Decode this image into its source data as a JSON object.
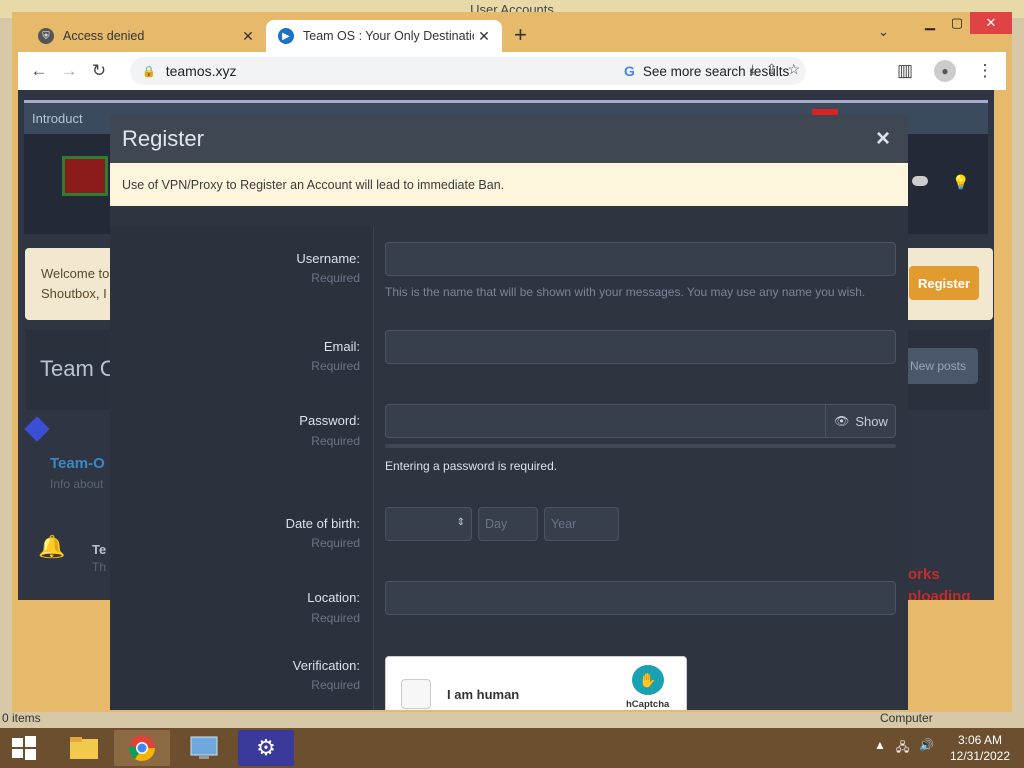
{
  "desktop": {
    "window_title": "User Accounts",
    "status_items": "0 items",
    "status_computer": "Computer"
  },
  "chrome": {
    "tabs": [
      {
        "title": "Access denied",
        "favicon": "shield-icon",
        "active": false
      },
      {
        "title": "Team OS : Your Only Destination",
        "favicon": "team-os-logo-icon",
        "active": true
      }
    ],
    "url": "teamos.xyz",
    "search_chip": "See more search results"
  },
  "page_bg": {
    "nav_item": "Introduct",
    "welcome_line1": "Welcome to",
    "welcome_line2": "Shoutbox, I",
    "register_button": "Register",
    "team_title": "Team O",
    "new_posts_button": "New posts",
    "teamo_title": "Team-O",
    "teamo_sub": "Info about",
    "te_title": "Te",
    "te_sub": "Th",
    "red_line1": "orks",
    "red_line2": "ploading"
  },
  "modal": {
    "title": "Register",
    "close": "×",
    "notice": "Use of VPN/Proxy to Register an Account will lead to immediate Ban.",
    "fields": {
      "username": {
        "label": "Username:",
        "required": "Required",
        "value": "",
        "hint": "This is the name that will be shown with your messages. You may use any name you wish."
      },
      "email": {
        "label": "Email:",
        "required": "Required",
        "value": ""
      },
      "password": {
        "label": "Password:",
        "required": "Required",
        "value": "",
        "show_button": "Show",
        "error": "Entering a password is required."
      },
      "dob": {
        "label": "Date of birth:",
        "required": "Required",
        "month_value": "",
        "day_placeholder": "Day",
        "year_placeholder": "Year"
      },
      "location": {
        "label": "Location:",
        "required": "Required",
        "value": ""
      },
      "verification": {
        "label": "Verification:",
        "required": "Required",
        "captcha_label": "I am human",
        "captcha_brand": "hCaptcha"
      }
    }
  },
  "taskbar": {
    "apps": [
      "file-explorer-icon",
      "chrome-icon",
      "control-panel-icon",
      "settings-icon"
    ],
    "time": "3:06 AM",
    "date": "12/31/2022"
  },
  "colors": {
    "modal_bg": "#2e3440",
    "modal_header": "#3f4753",
    "notice_bg": "#fdf5dc",
    "accent_orange": "#e29b2e",
    "chrome_frame": "#e6b96b"
  }
}
